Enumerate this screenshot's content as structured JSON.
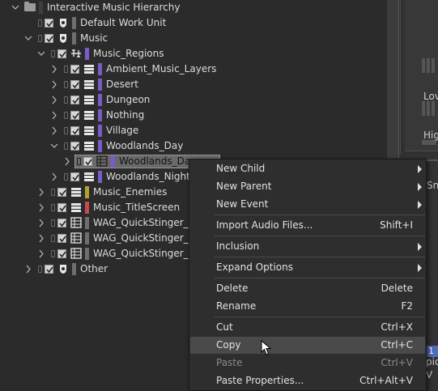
{
  "tree": {
    "items": [
      {
        "label": "Interactive Music Hierarchy",
        "icon": "folder-icon",
        "color": ""
      },
      {
        "label": "Default Work Unit",
        "icon": "work-unit-icon",
        "color": "#6e6e6e"
      },
      {
        "label": "Music",
        "icon": "work-unit-icon",
        "color": "#6e6e6e"
      },
      {
        "label": "Music_Regions",
        "icon": "music-switch-icon",
        "color": "#7a5cc8"
      },
      {
        "label": "Ambient_Music_Layers",
        "icon": "playlist-icon",
        "color": "#7a5cc8"
      },
      {
        "label": "Desert",
        "icon": "playlist-icon",
        "color": "#7a5cc8"
      },
      {
        "label": "Dungeon",
        "icon": "playlist-icon",
        "color": "#7a5cc8"
      },
      {
        "label": "Nothing",
        "icon": "playlist-icon",
        "color": "#7a5cc8"
      },
      {
        "label": "Village",
        "icon": "playlist-icon",
        "color": "#7a5cc8"
      },
      {
        "label": "Woodlands_Day",
        "icon": "playlist-icon",
        "color": "#7a5cc8"
      },
      {
        "label": "Woodlands_Day",
        "icon": "segment-icon",
        "color": "#7a5cc8"
      },
      {
        "label": "Woodlands_Night",
        "icon": "playlist-icon",
        "color": "#7a5cc8"
      },
      {
        "label": "Music_Enemies",
        "icon": "playlist-icon",
        "color": "#b3a22a"
      },
      {
        "label": "Music_TitleScreen",
        "icon": "playlist-icon",
        "color": "#c84a4a"
      },
      {
        "label": "WAG_QuickStinger_D",
        "icon": "segment-icon",
        "color": "#6e6e6e"
      },
      {
        "label": "WAG_QuickStinger_G",
        "icon": "segment-icon",
        "color": "#6e6e6e"
      },
      {
        "label": "WAG_QuickStinger_V",
        "icon": "segment-icon",
        "color": "#6e6e6e"
      },
      {
        "label": "Other",
        "icon": "work-unit-icon",
        "color": "#6e6e6e"
      }
    ]
  },
  "side_panel": {
    "low_label": "Lov",
    "high_label": "Hig",
    "snap_label": "Sn",
    "spice_label": "pic",
    "tag_text": "1",
    "v_label": "V"
  },
  "context_menu": {
    "items": [
      {
        "label": "New Child",
        "shortcut": "",
        "submenu": true,
        "disabled": false
      },
      {
        "label": "New Parent",
        "shortcut": "",
        "submenu": true,
        "disabled": false
      },
      {
        "label": "New Event",
        "shortcut": "",
        "submenu": true,
        "disabled": false
      },
      {
        "label": "Import Audio Files...",
        "shortcut": "Shift+I",
        "submenu": false,
        "disabled": false
      },
      {
        "label": "Inclusion",
        "shortcut": "",
        "submenu": true,
        "disabled": false
      },
      {
        "label": "Expand Options",
        "shortcut": "",
        "submenu": true,
        "disabled": false
      },
      {
        "label": "Delete",
        "shortcut": "Delete",
        "submenu": false,
        "disabled": false
      },
      {
        "label": "Rename",
        "shortcut": "F2",
        "submenu": false,
        "disabled": false
      },
      {
        "label": "Cut",
        "shortcut": "Ctrl+X",
        "submenu": false,
        "disabled": false
      },
      {
        "label": "Copy",
        "shortcut": "Ctrl+C",
        "submenu": false,
        "disabled": false,
        "hovered": true
      },
      {
        "label": "Paste",
        "shortcut": "Ctrl+V",
        "submenu": false,
        "disabled": true
      },
      {
        "label": "Paste Properties...",
        "shortcut": "Ctrl+Alt+V",
        "submenu": false,
        "disabled": false
      }
    ]
  }
}
